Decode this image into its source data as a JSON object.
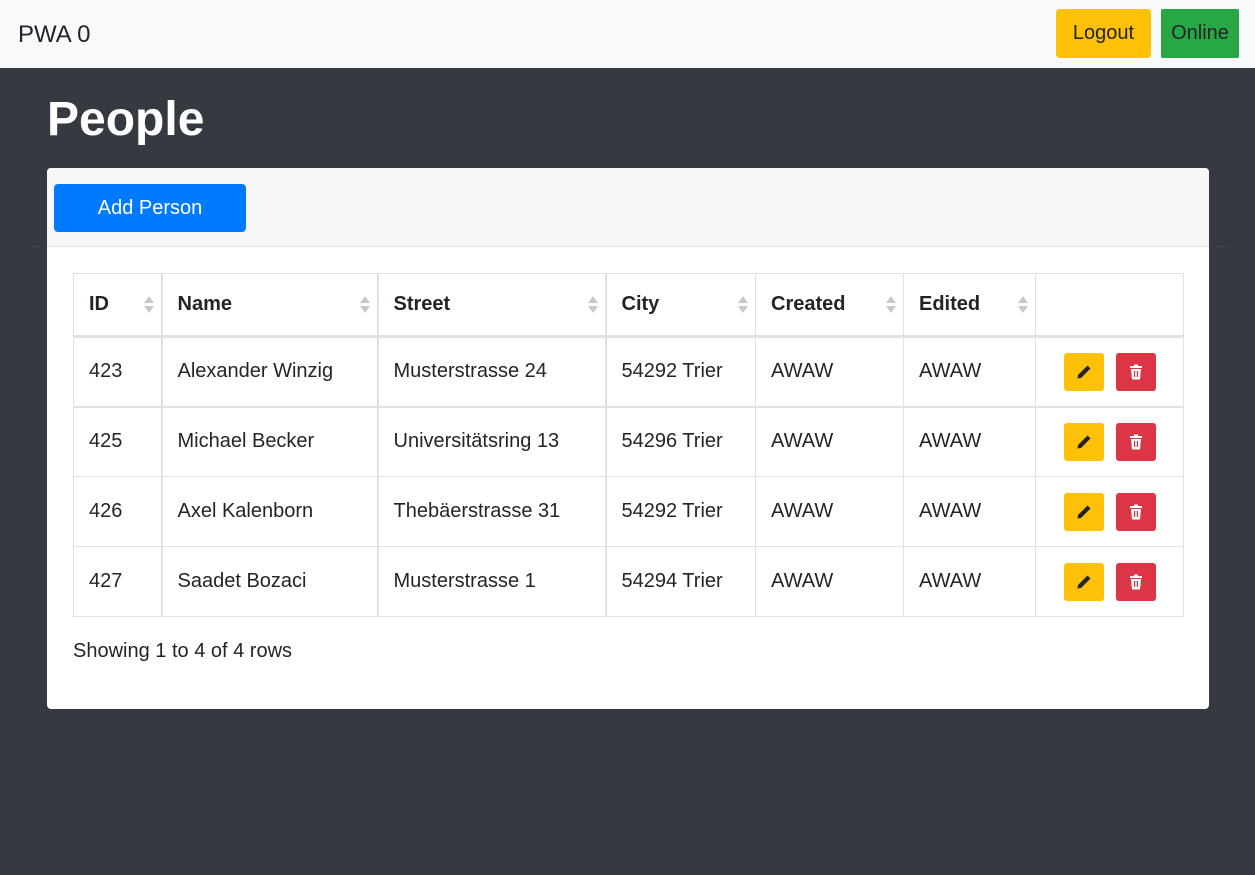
{
  "navbar": {
    "brand": "PWA 0",
    "logout_label": "Logout",
    "status_label": "Online"
  },
  "page": {
    "title": "People"
  },
  "toolbar": {
    "add_label": "Add Person"
  },
  "table": {
    "columns": [
      "ID",
      "Name",
      "Street",
      "City",
      "Created",
      "Edited"
    ],
    "rows": [
      {
        "id": "423",
        "name": "Alexander Winzig",
        "street": "Musterstrasse 24",
        "city": "54292 Trier",
        "created": "AWAW",
        "edited": "AWAW"
      },
      {
        "id": "425",
        "name": "Michael Becker",
        "street": "Universitätsring 13",
        "city": "54296 Trier",
        "created": "AWAW",
        "edited": "AWAW"
      },
      {
        "id": "426",
        "name": "Axel Kalenborn",
        "street": "Thebäerstrasse 31",
        "city": "54292 Trier",
        "created": "AWAW",
        "edited": "AWAW"
      },
      {
        "id": "427",
        "name": "Saadet Bozaci",
        "street": "Musterstrasse 1",
        "city": "54294 Trier",
        "created": "AWAW",
        "edited": "AWAW"
      }
    ],
    "footer": "Showing 1 to 4 of 4 rows"
  },
  "icons": {
    "edit": "pencil-icon",
    "delete": "trash-icon"
  },
  "colors": {
    "navbar_bg": "#f8f9fa",
    "page_bg": "#343a40",
    "logout": "#ffc107",
    "online": "#28a745",
    "primary": "#007bff",
    "edit": "#ffc107",
    "delete": "#dc3545"
  }
}
